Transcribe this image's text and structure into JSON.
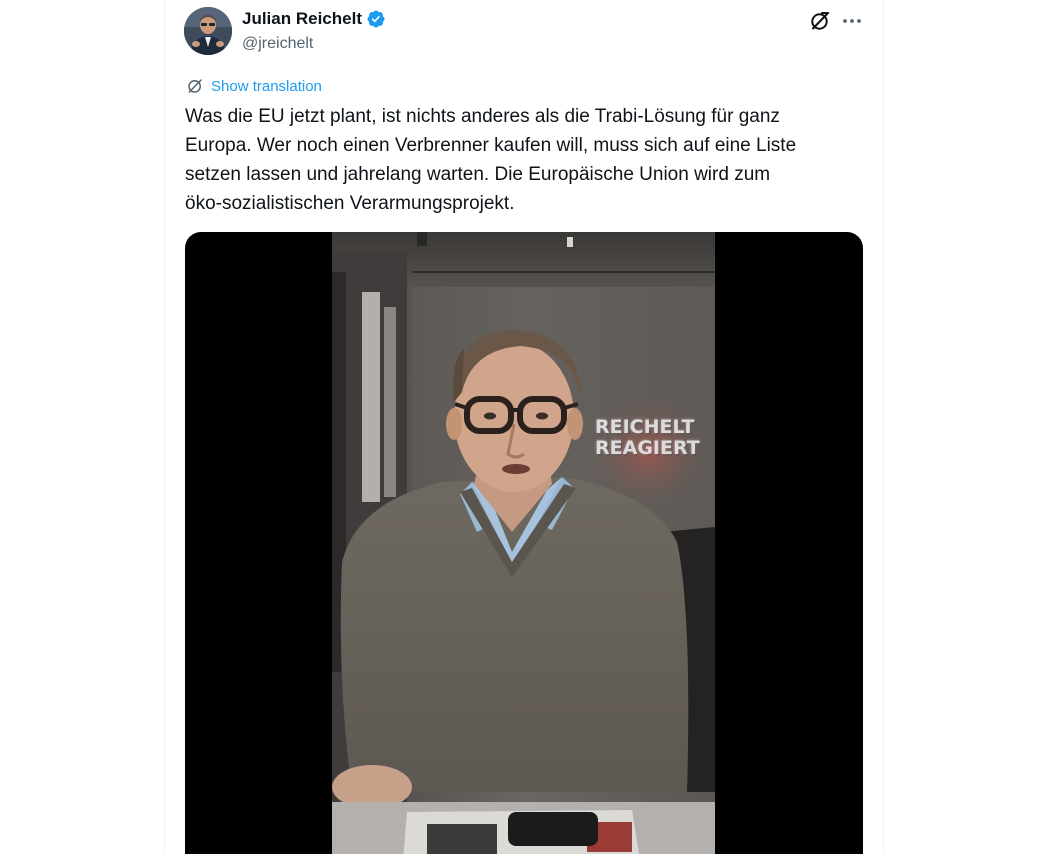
{
  "author": {
    "display_name": "Julian Reichelt",
    "handle": "@jreichelt",
    "verified": true
  },
  "actions": {
    "grok_icon": "grok-icon",
    "more_icon": "more-icon"
  },
  "translation": {
    "label": "Show translation"
  },
  "tweet": {
    "text": "Was die EU jetzt plant, ist nichts anderes als die Trabi-Lösung für ganz\nEuropa. Wer noch einen Verbrenner kaufen will, muss sich auf eine Liste\nsetzen lassen und jahrelang warten. Die Europäische Union wird zum\nöko-sozialistischen Verarmungsprojekt."
  },
  "video": {
    "overlay_line1": "REICHELT",
    "overlay_line2": "REAGIERT"
  },
  "colors": {
    "accent": "#1d9bf0",
    "text_primary": "#0f1419",
    "text_secondary": "#536471",
    "border": "#eff3f4"
  }
}
